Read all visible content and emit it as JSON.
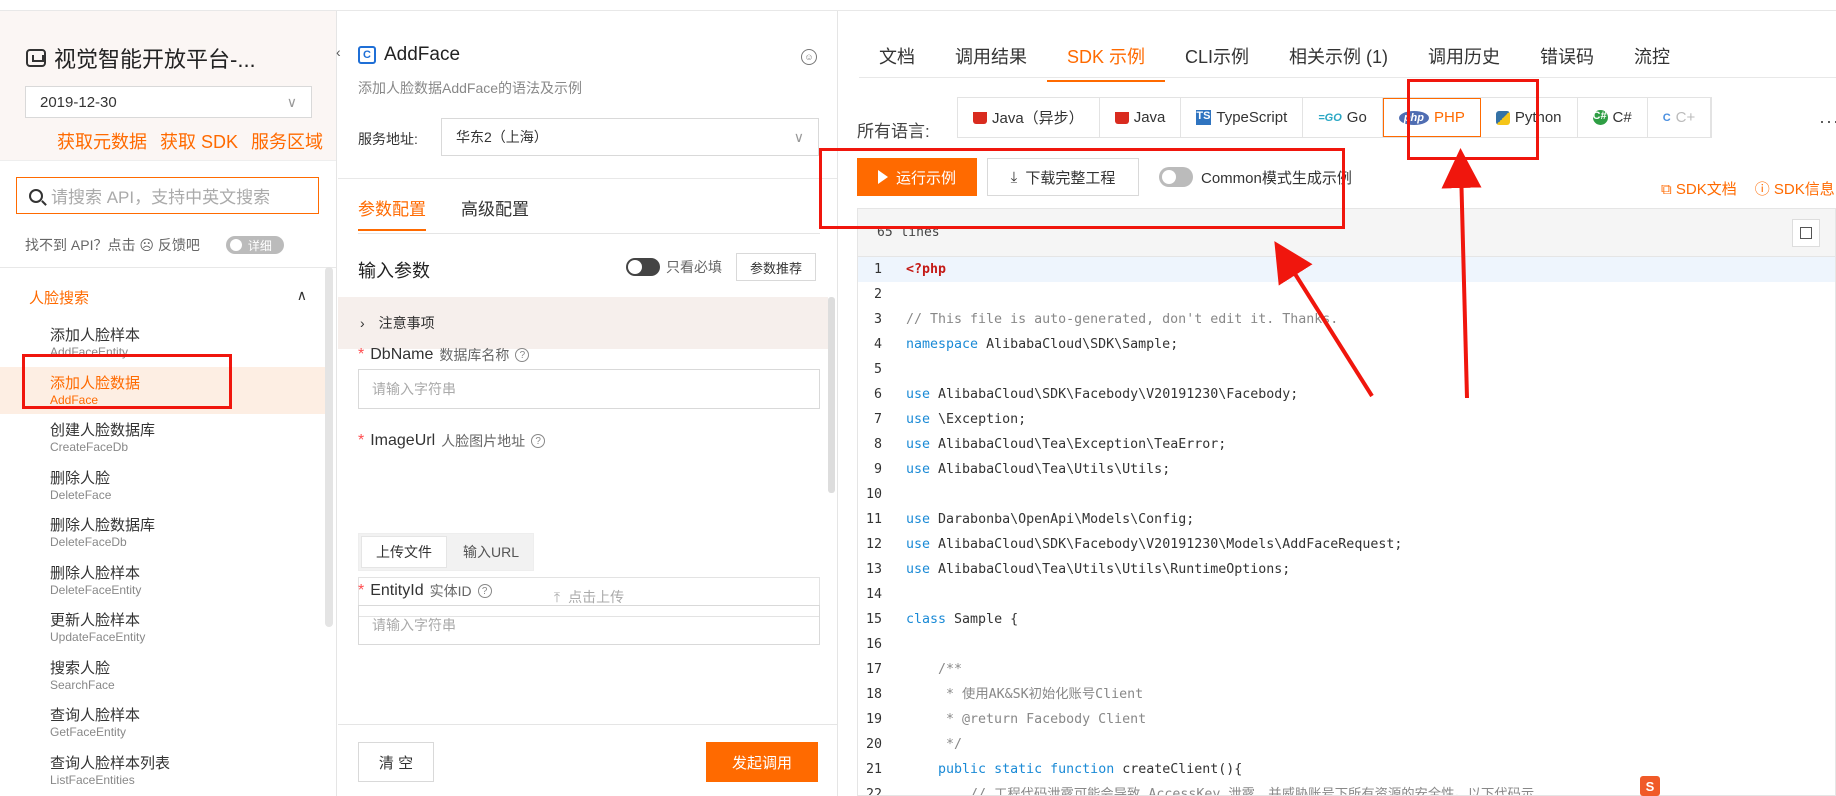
{
  "sidebar": {
    "app_title": "视觉智能开放平台-...",
    "version": "2019-12-30",
    "links": [
      "获取元数据",
      "获取 SDK",
      "服务区域"
    ],
    "search_placeholder": "请搜索 API，支持中英文搜索",
    "feedback_text": "找不到 API？点击 ☹ 反馈吧",
    "detail_toggle": "详细",
    "category": "人脸搜索",
    "items": [
      {
        "cn": "添加人脸样本",
        "en": "AddFaceEntity"
      },
      {
        "cn": "添加人脸数据",
        "en": "AddFace"
      },
      {
        "cn": "创建人脸数据库",
        "en": "CreateFaceDb"
      },
      {
        "cn": "删除人脸",
        "en": "DeleteFace"
      },
      {
        "cn": "删除人脸数据库",
        "en": "DeleteFaceDb"
      },
      {
        "cn": "删除人脸样本",
        "en": "DeleteFaceEntity"
      },
      {
        "cn": "更新人脸样本",
        "en": "UpdateFaceEntity"
      },
      {
        "cn": "搜索人脸",
        "en": "SearchFace"
      },
      {
        "cn": "查询人脸样本",
        "en": "GetFaceEntity"
      },
      {
        "cn": "查询人脸样本列表",
        "en": "ListFaceEntities"
      }
    ]
  },
  "middle": {
    "api_name": "AddFace",
    "api_desc": "添加人脸数据AddFace的语法及示例",
    "service_label": "服务地址:",
    "service_value": "华东2（上海）",
    "tabs": [
      "参数配置",
      "高级配置"
    ],
    "input_title": "输入参数",
    "only_required": "只看必填",
    "recommend": "参数推荐",
    "notice": "注意事项",
    "fields": [
      {
        "name": "DbName",
        "desc": "数据库名称",
        "placeholder": "请输入字符串"
      },
      {
        "name": "ImageUrl",
        "desc": "人脸图片地址"
      },
      {
        "name": "EntityId",
        "desc": "实体ID",
        "placeholder": "请输入字符串"
      }
    ],
    "upload_tabs": [
      "上传文件",
      "输入URL"
    ],
    "upload_hint": "点击上传",
    "clear": "清 空",
    "invoke": "发起调用"
  },
  "right": {
    "tabs": [
      "文档",
      "调用结果",
      "SDK 示例",
      "CLI示例",
      "相关示例 (1)",
      "调用历史",
      "错误码",
      "流控"
    ],
    "lang_label": "所有语言:",
    "languages": [
      {
        "label": "Java（异步）",
        "icon": "java-icon"
      },
      {
        "label": "Java",
        "icon": "java-icon"
      },
      {
        "label": "TypeScript",
        "icon": "typescript-icon"
      },
      {
        "label": "Go",
        "icon": "go-icon"
      },
      {
        "label": "PHP",
        "icon": "php-icon"
      },
      {
        "label": "Python",
        "icon": "python-icon"
      },
      {
        "label": "C#",
        "icon": "csharp-icon"
      },
      {
        "label": "C+",
        "icon": "cpp-icon"
      }
    ],
    "more": "···",
    "run_label": "运行示例",
    "download_label": "下载完整工程",
    "common_label": "Common模式生成示例",
    "sdk_doc": "SDK文档",
    "sdk_info": "SDK信息",
    "lines_label": "65 lines",
    "code": [
      {
        "n": "1",
        "t": "<?php"
      },
      {
        "n": "2",
        "t": ""
      },
      {
        "n": "3",
        "t": "// This file is auto-generated, don't edit it. Thanks."
      },
      {
        "n": "4",
        "t": "namespace AlibabaCloud\\SDK\\Sample;"
      },
      {
        "n": "5",
        "t": ""
      },
      {
        "n": "6",
        "t": "use AlibabaCloud\\SDK\\Facebody\\V20191230\\Facebody;"
      },
      {
        "n": "7",
        "t": "use \\Exception;"
      },
      {
        "n": "8",
        "t": "use AlibabaCloud\\Tea\\Exception\\TeaError;"
      },
      {
        "n": "9",
        "t": "use AlibabaCloud\\Tea\\Utils\\Utils;"
      },
      {
        "n": "10",
        "t": ""
      },
      {
        "n": "11",
        "t": "use Darabonba\\OpenApi\\Models\\Config;"
      },
      {
        "n": "12",
        "t": "use AlibabaCloud\\SDK\\Facebody\\V20191230\\Models\\AddFaceRequest;"
      },
      {
        "n": "13",
        "t": "use AlibabaCloud\\Tea\\Utils\\Utils\\RuntimeOptions;"
      },
      {
        "n": "14",
        "t": ""
      },
      {
        "n": "15",
        "t": "class Sample {"
      },
      {
        "n": "16",
        "t": ""
      },
      {
        "n": "17",
        "t": "    /**"
      },
      {
        "n": "18",
        "t": "     * 使用AK&SK初始化账号Client"
      },
      {
        "n": "19",
        "t": "     * @return Facebody Client"
      },
      {
        "n": "20",
        "t": "     */"
      },
      {
        "n": "21",
        "t": "    public static function createClient(){"
      },
      {
        "n": "22",
        "t": "        // 工程代码泄露可能会导致 AccessKey 泄露，并威胁账号下所有资源的安全性。以下代码示"
      }
    ]
  }
}
